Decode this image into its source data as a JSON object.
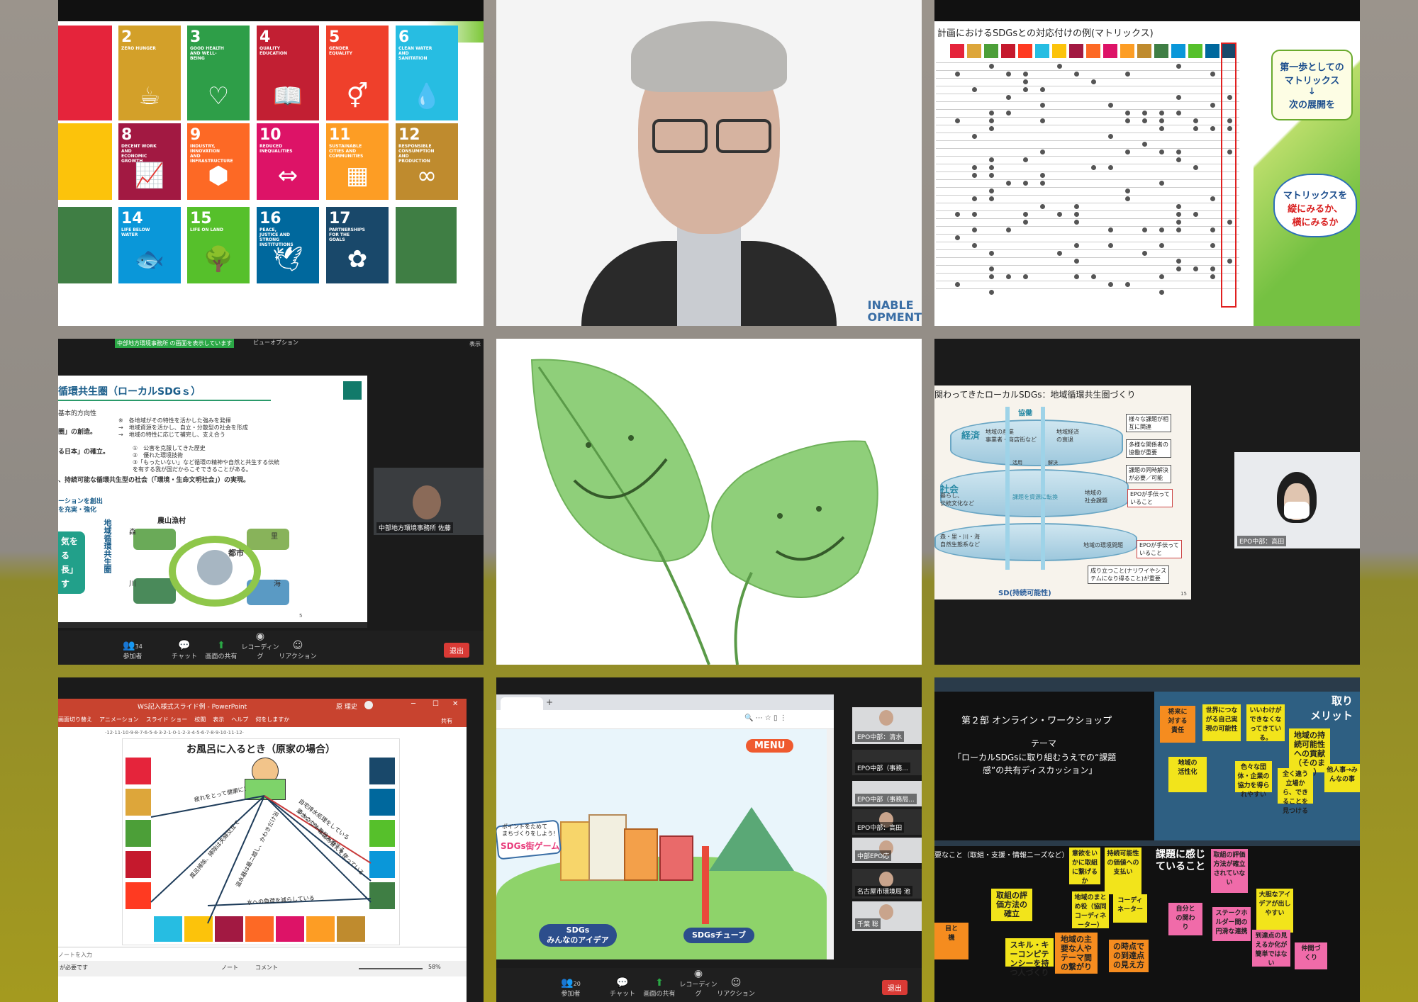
{
  "tile1": {
    "sdgs": [
      {
        "num": "2",
        "label": "ZERO HUNGER",
        "color": "#d3a029",
        "icon": "☕"
      },
      {
        "num": "3",
        "label": "GOOD HEALTH AND WELL-BEING",
        "color": "#2e9e48",
        "icon": "♡"
      },
      {
        "num": "4",
        "label": "QUALITY EDUCATION",
        "color": "#c21f33",
        "icon": "📖"
      },
      {
        "num": "5",
        "label": "GENDER EQUALITY",
        "color": "#ef402b",
        "icon": "⚥"
      },
      {
        "num": "6",
        "label": "CLEAN WATER AND SANITATION",
        "color": "#27bde2",
        "icon": "💧"
      },
      {
        "num": "8",
        "label": "DECENT WORK AND ECONOMIC GROWTH",
        "color": "#a21942",
        "icon": "📈"
      },
      {
        "num": "9",
        "label": "INDUSTRY, INNOVATION AND INFRASTRUCTURE",
        "color": "#fd6925",
        "icon": "⬢"
      },
      {
        "num": "10",
        "label": "REDUCED INEQUALITIES",
        "color": "#dd1367",
        "icon": "⇔"
      },
      {
        "num": "11",
        "label": "SUSTAINABLE CITIES AND COMMUNITIES",
        "color": "#fd9d24",
        "icon": "▦"
      },
      {
        "num": "12",
        "label": "RESPONSIBLE CONSUMPTION AND PRODUCTION",
        "color": "#bf8b2e",
        "icon": "∞"
      },
      {
        "num": "14",
        "label": "LIFE BELOW WATER",
        "color": "#0a97d9",
        "icon": "🐟"
      },
      {
        "num": "15",
        "label": "LIFE ON LAND",
        "color": "#56c02b",
        "icon": "🌳"
      },
      {
        "num": "16",
        "label": "PEACE, JUSTICE AND STRONG INSTITUTIONS",
        "color": "#00689d",
        "icon": "🕊"
      },
      {
        "num": "17",
        "label": "PARTNERSHIPS FOR THE GOALS",
        "color": "#19486a",
        "icon": "✿"
      }
    ]
  },
  "tile2": {
    "watermark": "INABLE\nOPMENT"
  },
  "tile3": {
    "title": "計画におけるSDGsとの対応付けの例(マトリックス)",
    "note1_a": "第一歩としての",
    "note1_b": "マトリックス",
    "note1_c": "↓",
    "note1_d": "次の展開を",
    "note2_a": "マトリックスを",
    "note2_b": "縦にみるか、",
    "note2_c": "横にみるか"
  },
  "tile4": {
    "top_text": "中部地方環境事務所 の画面を表示しています",
    "view_option": "ビューオプション",
    "slide_title": "循環共生圏（ローカルSDGｓ）",
    "line1": "基本的方向性",
    "line2": "※　各地域がその特性を活かした強みを発揮",
    "line3": "→　地域資源を活かし、自立・分散型の社会を形成",
    "line4": "→　地域の特性に応じて補完し、支え合う",
    "line5": "圏」の創造。",
    "line6": "る日本」の確立。",
    "line7": "①　公害を克服してきた歴史",
    "line8": "②　優れた環境技術",
    "line9": "③「もったいない」など循環の精神や自然と共生する伝統",
    "line10": "を有する我が国だからこそできることがある。",
    "line11": "、持続可能な循環共生型の社会（「環境・生命文明社会」）の実現。",
    "line12": "ーションを創出",
    "line13": "を充実・強化",
    "green_box": "気を\nる\n長」\nす",
    "side_label": "地域循環共生圏",
    "rural": "農山漁村",
    "forest": "森",
    "village": "里",
    "city": "都市",
    "river": "川",
    "sea": "海",
    "page": "5",
    "participant_name": "中部地方環境事務所 佐藤",
    "toolbar": {
      "participants": "参加者",
      "participants_count": "34",
      "chat": "チャット",
      "share": "画面の共有",
      "record": "レコーディング",
      "reaction": "リアクション",
      "leave": "退出"
    },
    "show": "表示"
  },
  "tile6": {
    "title": "関わってきたローカルSDGs：地域循環共生圏づくり",
    "collab": "協働",
    "economy": "経済",
    "econ_sub": "地域の産業\n事業者・商店街など",
    "econ_issue": "地域経済\nの衰退",
    "society": "社会",
    "soc_sub": "暮らし、\n伝統文化など",
    "soc_issue": "地域の\n社会課題",
    "env_sub": "森・里・川・海\n自然生態系など",
    "env_issue": "地域の環境問題",
    "bubble1": "様々な課題が相\n互に関連",
    "bubble2": "多様な関係者の\n協働が重要",
    "bubble3": "課題の同時解決\nが必要／可能",
    "bubble4": "EPOが手伝って\nいること",
    "bubble5": "EPOが手伝って\nいること",
    "bubble6": "成り立つこと(ナリワイやシス\nテムになり得ること)が重要",
    "sd": "SD(持続可能性)",
    "act": "活用",
    "solve": "解決",
    "transform": "課題を資源に転換",
    "page": "15",
    "participant_name": "EPO中部：高田"
  },
  "tile7": {
    "window_title": "WS記入様式スライド例 - PowerPoint",
    "user": "原 理史",
    "ribbon": [
      "画面切り替え",
      "アニメーション",
      "スライド ショー",
      "校閲",
      "表示",
      "ヘルプ",
      "何をしますか"
    ],
    "share": "共有",
    "ruler": "·12·11·10·9·8·7·6·5·4·3·2·1·0·1·2·3·4·5·6·7·8·9·10·11·12·",
    "slide_title": "お風呂に入るとき（原家の場合）",
    "arrow1": "疲れをとって健康に！",
    "arrow2": "風呂掃除、掃除は夫婦交互で",
    "arrow3": "温水器は最ニ越し、かわきだけ浴",
    "arrow4": "シャンプーは詰め替えを使っている",
    "arrow5": "水への負荷を減らしている",
    "arrow6": "自宅排水処理をしている",
    "arrow7": "節水のため毎日入浴する",
    "notes": "ノートを入力",
    "status": "が必要です",
    "notes_btn": "ノート",
    "comments_btn": "コメント",
    "zoom": "58%"
  },
  "tile8": {
    "menu": "MENU",
    "banner1": "ポイントをためて",
    "banner2": "まちづくりをしよう！",
    "banner3": "SDGs街ゲーム",
    "btn1": "SDGs\nみんなのアイデア",
    "btn2": "SDGsチューブ",
    "gallery": [
      {
        "name": "EPO中部：清水"
      },
      {
        "name": "EPO中部（事務..."
      },
      {
        "name": "EPO中部（事務局..."
      },
      {
        "name": "EPO中部：高田"
      },
      {
        "name": "中部EPO応"
      },
      {
        "name": "名古屋市環境局 池"
      },
      {
        "name": "千葉 聡"
      }
    ],
    "toolbar": {
      "participants": "参加者",
      "participants_count": "20",
      "chat": "チャット",
      "share": "画面の共有",
      "record": "レコーディング",
      "reaction": "リアクション",
      "leave": "退出"
    }
  },
  "tile9": {
    "heading": "第２部 オンライン・ワークショップ",
    "theme_label": "テーマ",
    "theme1": "「ローカルSDGsに取り組むうえでの“課題",
    "theme2": "感”の共有ディスカッション」",
    "corner": "取り\nメリット",
    "section2": "要なこと（取組・支援・情報ニーズなど）",
    "section3": "課題に感じ\nていること",
    "stickies": [
      {
        "text": "将来に\n対する\n責任",
        "color": "#f58c1f"
      },
      {
        "text": "世界につながる自己実現の可能性",
        "color": "#f2e41b"
      },
      {
        "text": "いいわけができなくなってきている。",
        "color": "#f2e41b"
      },
      {
        "text": "地域の持続可能性への貢献（そのまんま）",
        "color": "#f2e41b"
      },
      {
        "text": "地域の\n活性化",
        "color": "#f2e41b"
      },
      {
        "text": "色々な団体・企業の協力を得られやすい",
        "color": "#f2e41b"
      },
      {
        "text": "全く違う立場から、できることを見つける",
        "color": "#f2e41b"
      },
      {
        "text": "他人事→みんなの事",
        "color": "#f2e41b"
      },
      {
        "text": "持続可能性の価値への支払い",
        "color": "#f2e41b"
      },
      {
        "text": "意欲をいかに取組に繋げるか",
        "color": "#f2e41b"
      },
      {
        "text": "取組の評価方法の確立",
        "color": "#f2e41b"
      },
      {
        "text": "地域のまとめ役（協同コーディネーター）",
        "color": "#f2e41b"
      },
      {
        "text": "コーディネーター",
        "color": "#f2e41b"
      },
      {
        "text": "取組の評価方法が確立されていない",
        "color": "#f06ba9"
      },
      {
        "text": "大胆なアイデアが出しやすい",
        "color": "#f2e41b"
      },
      {
        "text": "自分と\nの関わ\nり",
        "color": "#f06ba9"
      },
      {
        "text": "ステークホルダー間の円滑な連携",
        "color": "#f06ba9"
      },
      {
        "text": "到達点の見えるか化が簡単ではない",
        "color": "#f06ba9"
      },
      {
        "text": "仲間づ\nくり",
        "color": "#f06ba9"
      },
      {
        "text": "スキル・キーコンピテンシーを持つ人づくり",
        "color": "#f2e41b"
      },
      {
        "text": "地域の主要な人やテーマ間の繋がり",
        "color": "#f58c1f"
      },
      {
        "text": "の時点での到達点の見え方",
        "color": "#f58c1f"
      },
      {
        "text": "目と\n機",
        "color": "#f58c1f"
      }
    ]
  }
}
